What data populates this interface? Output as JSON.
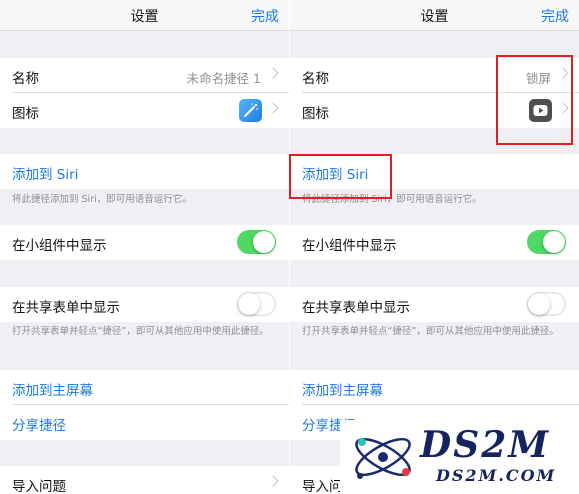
{
  "left": {
    "nav": {
      "title": "设置",
      "done": "完成"
    },
    "name": {
      "label": "名称",
      "value": "未命名捷径 1"
    },
    "icon": {
      "label": "图标",
      "icon": "magic-wand-icon",
      "color": "#1f7ce0"
    },
    "siri": {
      "label": "添加到 Siri",
      "note": "将此捷径添加到 Siri，即可用语音运行它。"
    },
    "widget": {
      "label": "在小组件中显示",
      "on": true
    },
    "share": {
      "label": "在共享表单中显示",
      "on": false,
      "note": "打开共享表单并轻点“捷径”，即可从其他应用中使用此捷径。"
    },
    "home": {
      "label": "添加到主屏幕"
    },
    "shareShortcut": {
      "label": "分享捷径"
    },
    "import": {
      "label": "导入问题"
    }
  },
  "right": {
    "nav": {
      "title": "设置",
      "done": "完成"
    },
    "name": {
      "label": "名称",
      "value": "锁屏"
    },
    "icon": {
      "label": "图标",
      "icon": "play-icon",
      "color": "#4f4f4f"
    },
    "siri": {
      "label": "添加到 Siri",
      "note": "将此捷径添加到 Siri，即可用语音运行它。"
    },
    "widget": {
      "label": "在小组件中显示",
      "on": true
    },
    "share": {
      "label": "在共享表单中显示",
      "on": false,
      "note": "打开共享表单并轻点“捷径”，即可从其他应用中使用此捷径。"
    },
    "home": {
      "label": "添加到主屏幕"
    },
    "shareShortcut": {
      "label": "分享捷径"
    },
    "import": {
      "label": "导入问题"
    }
  },
  "watermark": {
    "brand": "DS2M",
    "domain": "DS2M.COM"
  },
  "colors": {
    "accent": "#1a7ae8",
    "toggle_on": "#4cd964",
    "highlight": "#e02020"
  }
}
